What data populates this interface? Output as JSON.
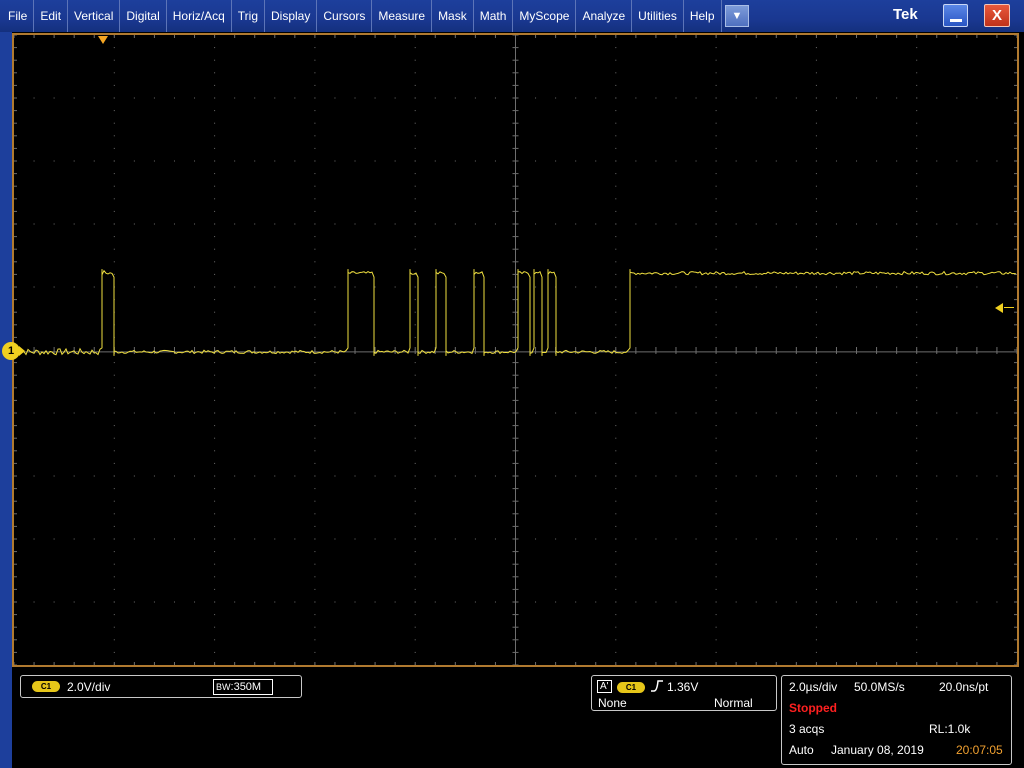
{
  "menu": {
    "items": [
      "File",
      "Edit",
      "Vertical",
      "Digital",
      "Horiz/Acq",
      "Trig",
      "Display",
      "Cursors",
      "Measure",
      "Mask",
      "Math",
      "MyScope",
      "Analyze",
      "Utilities",
      "Help"
    ],
    "dropdown_icon": "chevron-down-icon"
  },
  "brand": "Tek",
  "window_controls": {
    "minimize_icon": "minimize-icon",
    "close_label": "X"
  },
  "colors": {
    "trace": "#f0e040",
    "grid": "#6e6e6e",
    "graticule_border": "#b07a30",
    "menubar": "#1d3f9c",
    "stopped": "#ff2020",
    "time": "#f0a030"
  },
  "display": {
    "channel_marker": "1",
    "grid_divisions": {
      "horizontal": 10,
      "vertical": 10
    }
  },
  "vertical": {
    "channel_badge": "C1",
    "scale": "2.0V/div",
    "bw_prefix": "B",
    "bw_sub": "W",
    "bw_value": ":350M"
  },
  "trigger": {
    "source_prefix": "A'",
    "channel_badge": "C1",
    "slope_icon": "rising-edge-icon",
    "level": "1.36V",
    "coupling": "None",
    "mode": "Normal"
  },
  "horizontal": {
    "time_per_div": "2.0µs/div",
    "sample_rate": "50.0MS/s",
    "resolution": "20.0ns/pt",
    "status": "Stopped",
    "acqs": "3 acqs",
    "record_length": "RL:1.0k",
    "mode": "Auto",
    "date": "January 08, 2019",
    "time": "20:07:05"
  },
  "waveform": {
    "unit_x": "divisions",
    "unit_y": "divisions above ground",
    "low_level": 0,
    "high_level": 1.25,
    "pulses": [
      {
        "start": 0.86,
        "end": 0.98
      },
      {
        "start": 3.32,
        "end": 3.58
      },
      {
        "start": 3.93,
        "end": 4.02
      },
      {
        "start": 4.19,
        "end": 4.29
      },
      {
        "start": 4.57,
        "end": 4.68
      },
      {
        "start": 5.02,
        "end": 5.13
      },
      {
        "start": 5.18,
        "end": 5.25
      },
      {
        "start": 5.31,
        "end": 5.4
      },
      {
        "start": 6.13,
        "end": 10.0
      }
    ]
  }
}
